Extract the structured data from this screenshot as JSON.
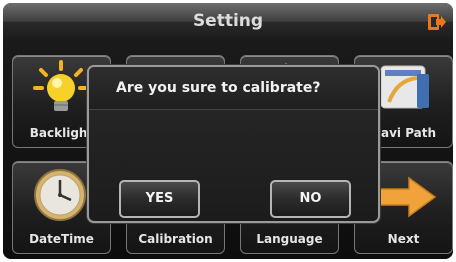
{
  "header": {
    "title": "Setting",
    "exit_icon": "exit-icon"
  },
  "tiles": [
    {
      "label": "Backlight",
      "icon": "bulb-icon"
    },
    {
      "label": "",
      "icon": "hidden-icon"
    },
    {
      "label": "",
      "icon": "hidden-icon"
    },
    {
      "label": "Navi Path",
      "icon": "folder-icon"
    },
    {
      "label": "DateTime",
      "icon": "clock-icon"
    },
    {
      "label": "Calibration",
      "icon": "calibration-icon"
    },
    {
      "label": "Language",
      "icon": "language-icon"
    },
    {
      "label": "Next",
      "icon": "arrow-right-icon"
    }
  ],
  "dialog": {
    "message": "Are you sure to calibrate?",
    "yes_label": "YES",
    "no_label": "NO"
  },
  "colors": {
    "accent": "#e8781a",
    "background": "#0f0f0f",
    "text": "#e6e6e6"
  }
}
